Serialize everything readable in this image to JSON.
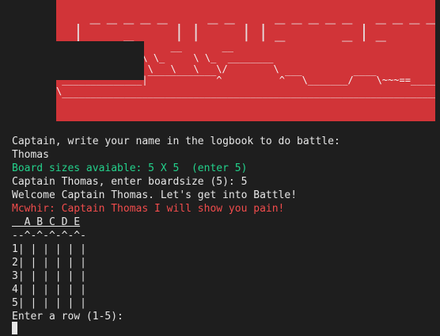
{
  "banner": {
    "title_lines": "  _____  __  _____ _____  _    _____  _____ _  _  _  _____  _____\n |  _  ||  ||_   _|_   _|| |  |  ___||  ___|| || || ||  _  ||  ___|",
    "art": "                    __       __\n               \\ \\_     \\ \\_  ________\n                \\   \\   \\   \\/        \\\n ______________|‾‾‾‾‾‾‾‾‾‾‾‾^          ^‾‾‾\\_______/‾‾‾‾\\~~~==______\n\\                                                                  /\n ‾‾‾‾‾‾‾‾‾‾‾‾‾‾‾‾‾‾‾‾‾‾‾‾‾‾‾‾‾‾‾‾‾‾‾‾‾‾‾‾‾‾‾‾‾‾‾‾‾‾‾‾‾‾‾‾‾‾‾‾‾‾‾‾‾‾‾",
    "colors": {
      "background": "#d13438",
      "text": "#f5f5f5"
    }
  },
  "lines": {
    "prompt_name": "Captain, write your name in the logbook to do battle:",
    "input_name": "Thomas",
    "board_sizes": "Board sizes avaiable: 5 X 5  (enter 5)",
    "boardsize_prompt": "Captain Thomas, enter boardsize (5): 5",
    "welcome": "Welcome Captain Thomas. Let's get into Battle!",
    "enemy_taunt": "Mcwhir: Captain Thomas I will show you pain!",
    "board_header": "  A B C D E",
    "board_divider": "--^-^-^-^-^-",
    "row_1": "1| | | | | |",
    "row_2": "2| | | | | |",
    "row_3": "3| | | | | |",
    "row_4": "4| | | | | |",
    "row_5": "5| | | | | |",
    "row_prompt": "Enter a row (1-5):"
  },
  "colors": {
    "terminal_bg": "#1e1e1e",
    "text": "#e6e6e6",
    "green": "#23d18b",
    "red": "#f14c4c"
  }
}
